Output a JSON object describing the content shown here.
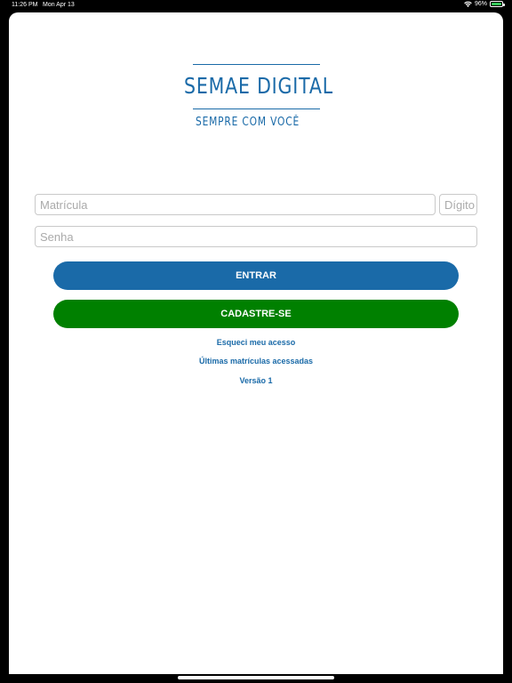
{
  "status_bar": {
    "time": "11:26 PM",
    "date": "Mon Apr 13",
    "battery_percent": "96%",
    "battery_level": 0.96,
    "icons": [
      "wifi-icon",
      "battery-icon"
    ],
    "battery_color": "#34c759"
  },
  "logo": {
    "wordmark": "SEMAE DIGITAL",
    "tagline": "SEMPRE COM VOCÊ",
    "color": "#1a6aa8"
  },
  "form": {
    "matricula_placeholder": "Matrícula",
    "digito_placeholder": "Dígito",
    "senha_placeholder": "Senha"
  },
  "buttons": {
    "entrar_label": "ENTRAR",
    "cadastre_label": "CADASTRE-SE",
    "entrar_color": "#1a6aa8",
    "cadastre_color": "#008000"
  },
  "links": {
    "forgot": "Esqueci meu acesso",
    "recent": "Últimas matrículas acessadas",
    "version": "Versão 1"
  }
}
